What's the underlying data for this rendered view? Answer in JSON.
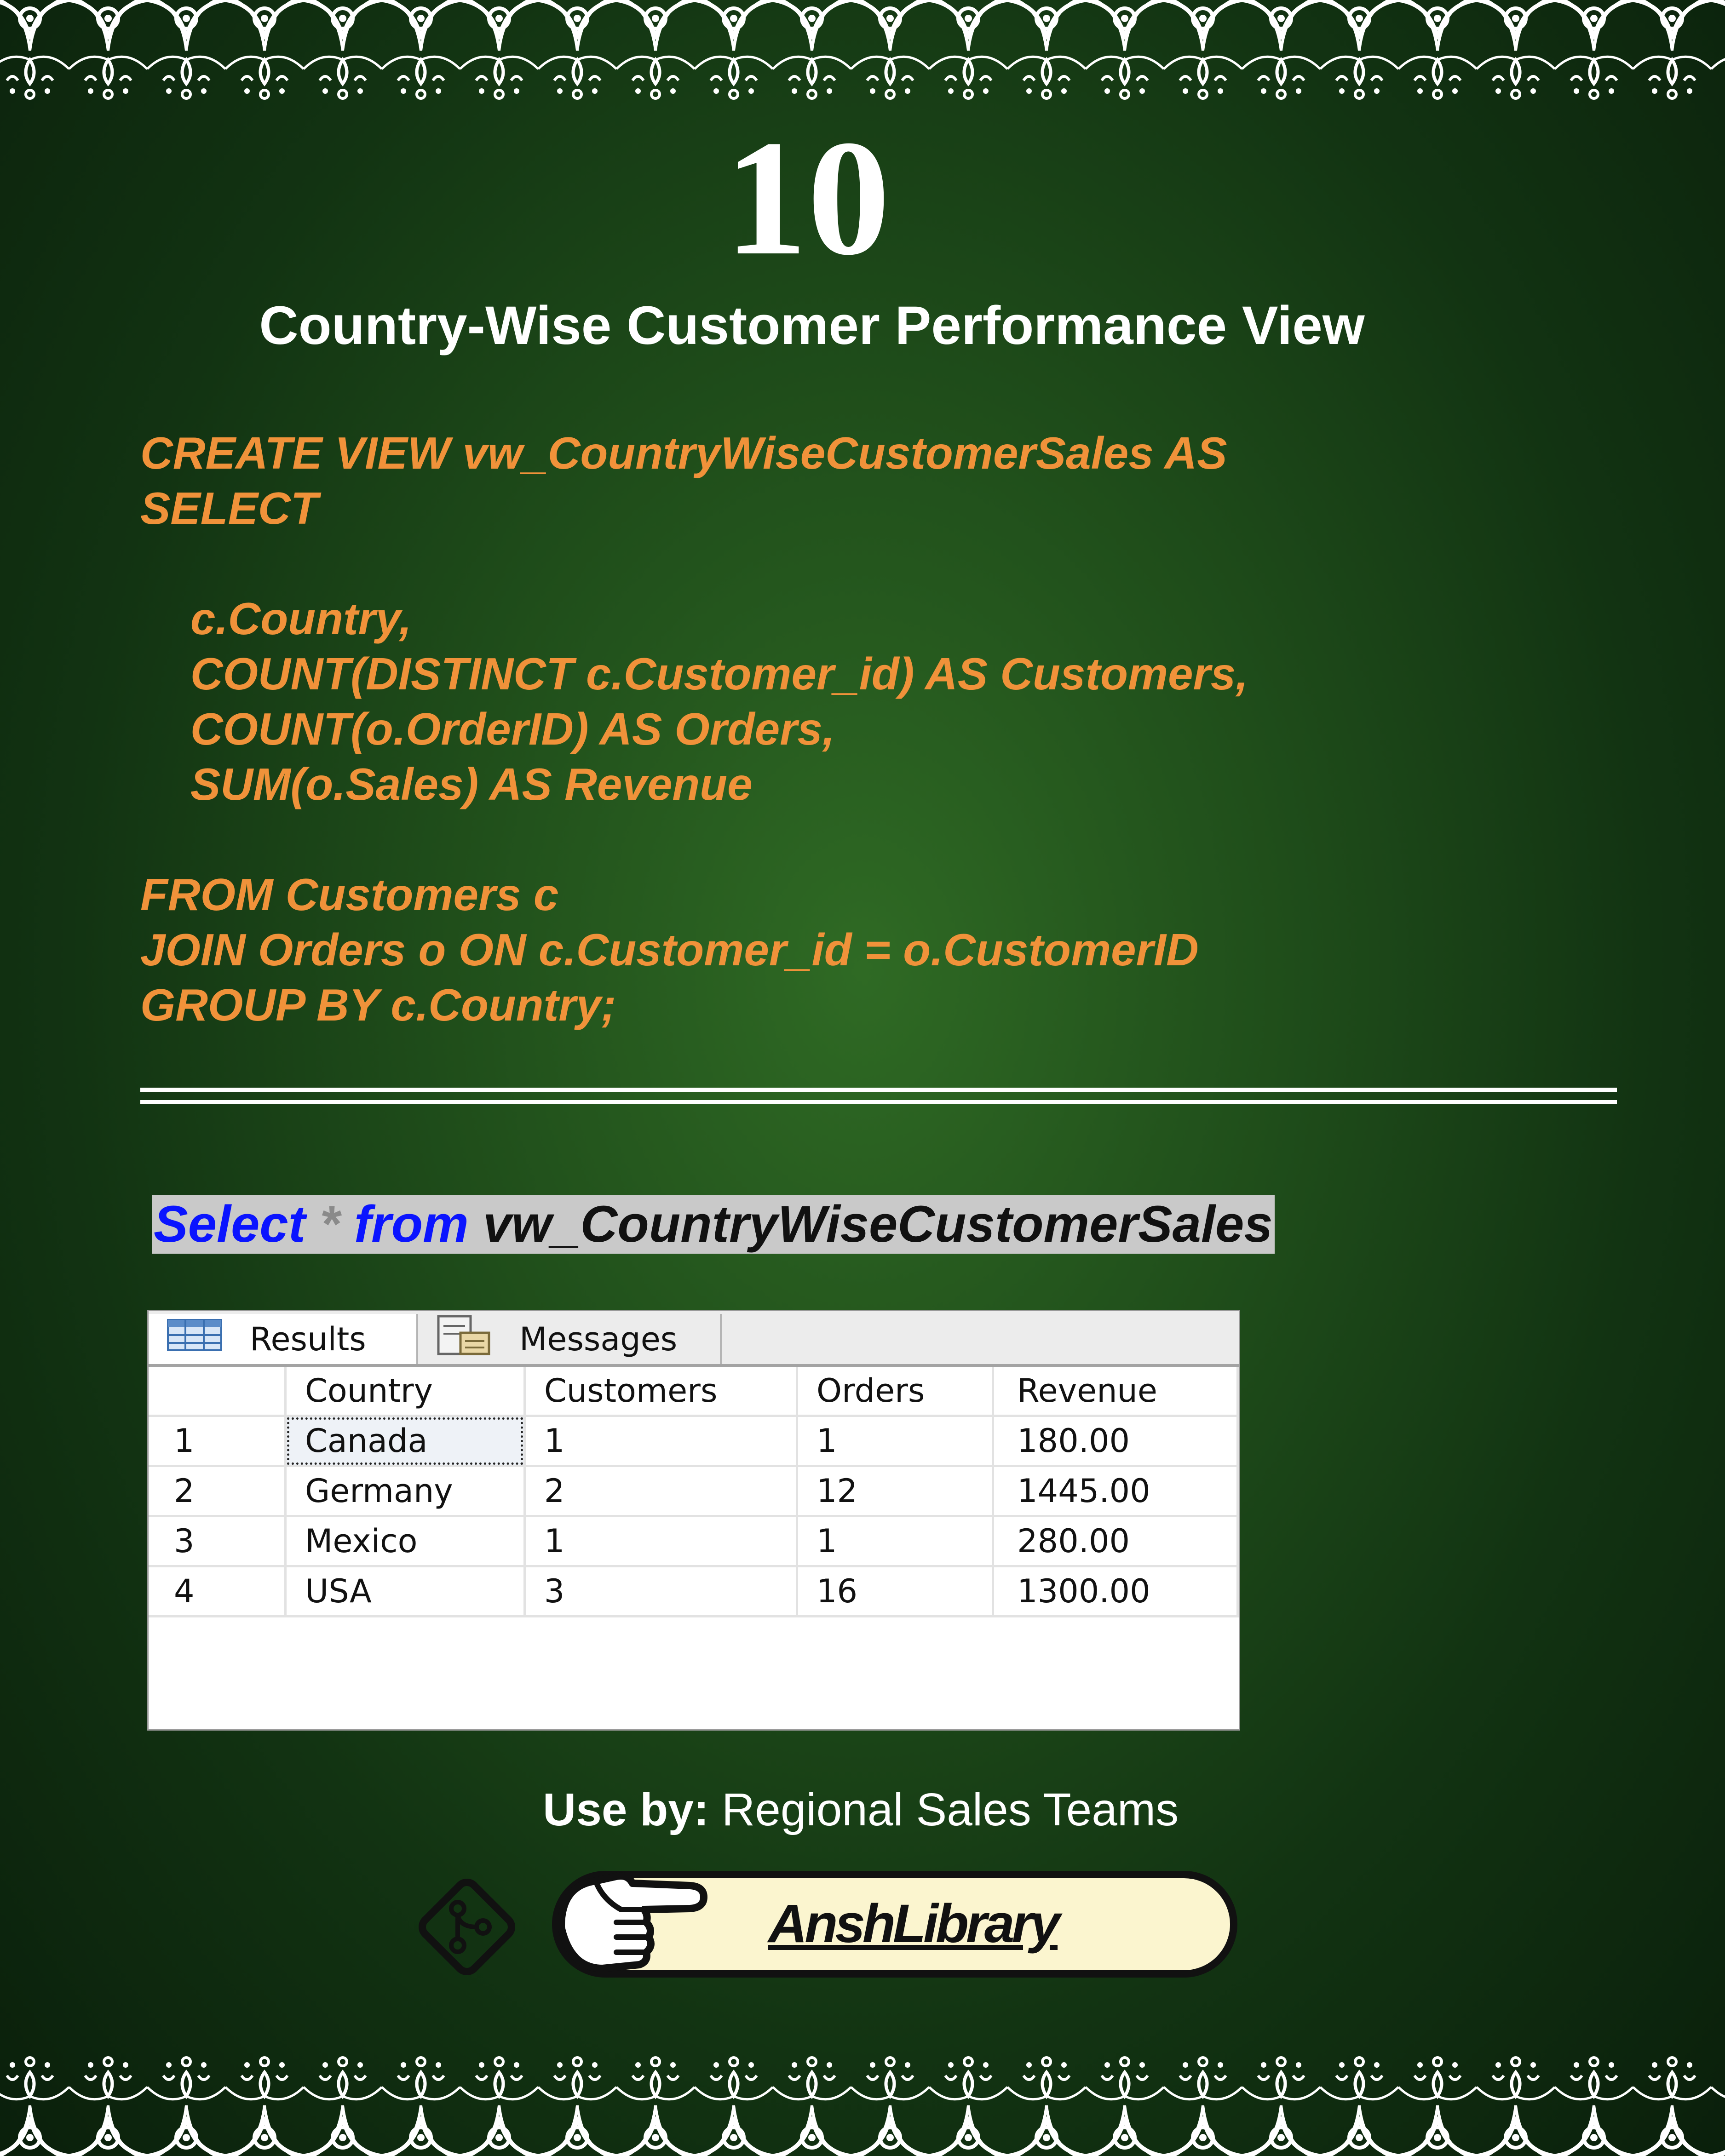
{
  "page_number": "10",
  "title": "Country-Wise Customer Performance View",
  "sql_code": "CREATE VIEW vw_CountryWiseCustomerSales AS\nSELECT\n\n    c.Country,\n    COUNT(DISTINCT c.Customer_id) AS Customers,\n    COUNT(o.OrderID) AS Orders,\n    SUM(o.Sales) AS Revenue\n\nFROM Customers c\nJOIN Orders o ON c.Customer_id = o.CustomerID\nGROUP BY c.Country;",
  "query": {
    "select_kw": "Select",
    "star": "*",
    "from_kw": "from",
    "object": "vw_CountryWiseCustomerSales"
  },
  "results": {
    "tabs": [
      {
        "label": "Results",
        "icon": "grid-icon"
      },
      {
        "label": "Messages",
        "icon": "messages-icon"
      }
    ],
    "columns": [
      "",
      "Country",
      "Customers",
      "Orders",
      "Revenue"
    ],
    "rows": [
      [
        "1",
        "Canada",
        "1",
        "1",
        "180.00"
      ],
      [
        "2",
        "Germany",
        "2",
        "12",
        "1445.00"
      ],
      [
        "3",
        "Mexico",
        "1",
        "1",
        "280.00"
      ],
      [
        "4",
        "USA",
        "3",
        "16",
        "1300.00"
      ]
    ]
  },
  "usage": {
    "label": "Use by:",
    "value": "Regional Sales Teams"
  },
  "library": {
    "name": "AnshLibrary",
    "icons": [
      "share-icon",
      "pointing-hand-icon"
    ]
  },
  "colors": {
    "code": "#f0923a",
    "keyword": "#0a14ff",
    "pill": "#fbf5cf"
  }
}
